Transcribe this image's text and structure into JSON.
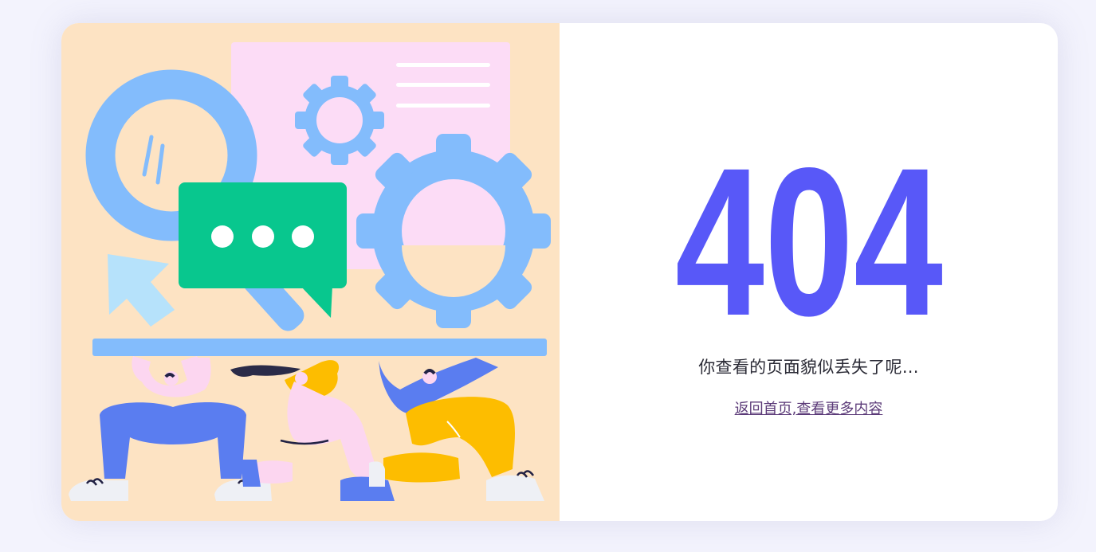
{
  "error": {
    "code": "404",
    "message": "你查看的页面貌似丢失了呢...",
    "link_label": "返回首页,查看更多内容"
  },
  "illustration": {
    "description_icons": [
      "magnifier-icon",
      "chat-bubble-icon",
      "gear-icon",
      "cursor-arrow-icon"
    ]
  },
  "colors": {
    "accent": "#5858f8",
    "illustration_bg": "#fde3c3",
    "page_bg": "#f3f3fd",
    "link": "#5b3a78"
  }
}
